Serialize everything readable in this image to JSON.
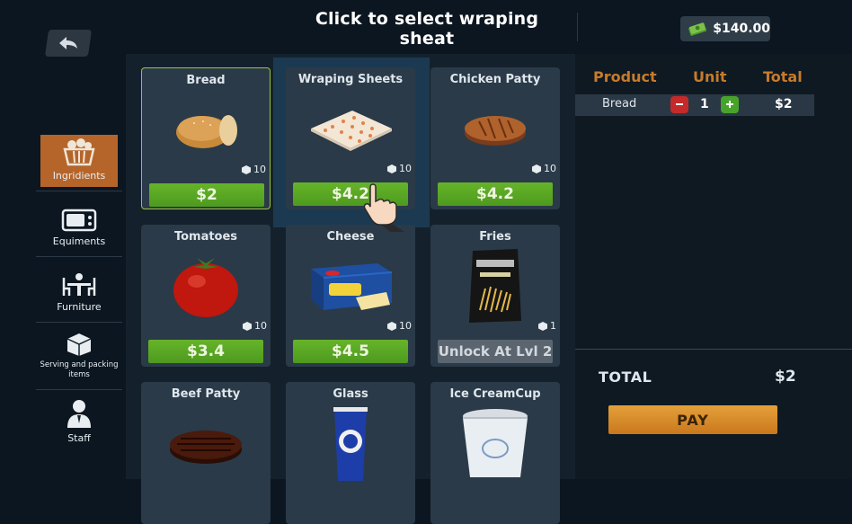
{
  "header": {
    "instruction": "Click to select wraping sheat",
    "money": "$140.00"
  },
  "sidebar": {
    "items": [
      {
        "label": "Ingridients",
        "icon": "basket-icon",
        "active": true
      },
      {
        "label": "Equiments",
        "icon": "microwave-icon"
      },
      {
        "label": "Furniture",
        "icon": "table-chairs-icon"
      },
      {
        "label": "Serving and packing items",
        "icon": "box-icon"
      },
      {
        "label": "Staff",
        "icon": "person-icon"
      }
    ]
  },
  "products": [
    {
      "name": "Bread",
      "qty": "10",
      "price": "$2",
      "icon": "bread-icon"
    },
    {
      "name": "Wraping Sheets",
      "qty": "10",
      "price": "$4.2",
      "icon": "wrapping-sheet-icon"
    },
    {
      "name": "Chicken Patty",
      "qty": "10",
      "price": "$4.2",
      "icon": "chicken-patty-icon"
    },
    {
      "name": "Tomatoes",
      "qty": "10",
      "price": "$3.4",
      "icon": "tomato-icon"
    },
    {
      "name": "Cheese",
      "qty": "10",
      "price": "$4.5",
      "icon": "cheese-icon"
    },
    {
      "name": "Fries",
      "qty": "1",
      "price": "Unlock At Lvl 2",
      "icon": "fries-bag-icon",
      "locked": true
    },
    {
      "name": "Beef Patty",
      "icon": "beef-patty-icon"
    },
    {
      "name": "Glass",
      "icon": "glass-icon"
    },
    {
      "name": "Ice CreamCup",
      "icon": "ice-cream-cup-icon"
    }
  ],
  "order": {
    "headers": {
      "product": "Product",
      "unit": "Unit",
      "total": "Total"
    },
    "rows": [
      {
        "product": "Bread",
        "unit": "1",
        "total": "$2"
      }
    ],
    "total_label": "TOTAL",
    "total_value": "$2",
    "pay_label": "PAY"
  },
  "colors": {
    "accent_orange": "#c77b2a",
    "price_green": "#5aa826",
    "selected_border": "#9cc43a",
    "active_tab": "#b5652a"
  }
}
